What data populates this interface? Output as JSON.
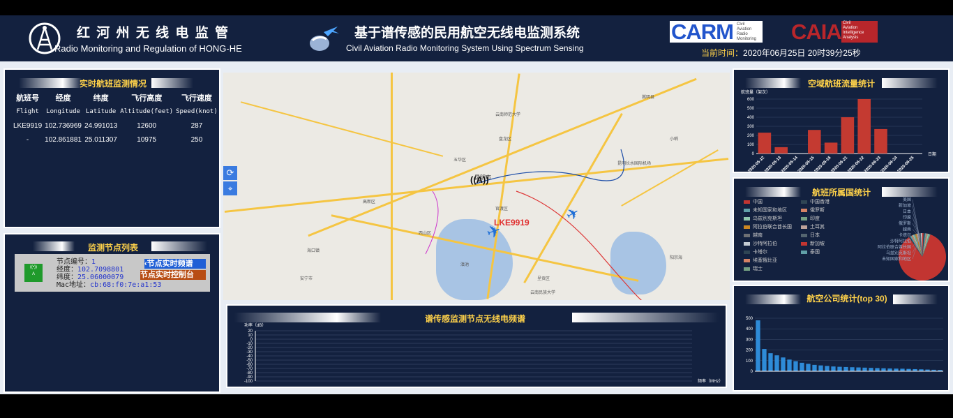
{
  "header": {
    "org_title": "红 河 州 无 线 电 监 管",
    "org_subtitle": "Radio Monitoring and Regulation of HONG-HE",
    "system_title": "基于谱传感的民用航空无线电监测系统",
    "system_subtitle": "Civil Aviation Radio Monitoring System Using Spectrum Sensing",
    "carm_logo": "CARM",
    "carm_tag": [
      "Civil",
      "Aviation",
      "Radio",
      "Monitoring"
    ],
    "caia_logo": "CAIA",
    "caia_tag": [
      "Civil",
      "Aviation",
      "Intelligence",
      "Analysis"
    ],
    "time_label": "当前时间：",
    "time_value": "2020年06月25日 20时39分25秒"
  },
  "flights_panel": {
    "title": "实时航班监测情况",
    "headers_cn": [
      "航班号",
      "经度",
      "纬度",
      "飞行高度",
      "飞行速度"
    ],
    "headers_en": [
      "Flight",
      "Longitude",
      "Latitude",
      "Altitude(feet)",
      "Speed(knot)"
    ],
    "rows": [
      [
        "LKE9919",
        "102.736969",
        "24.991013",
        "12600",
        "287"
      ],
      [
        "-",
        "102.861881",
        "25.011307",
        "10975",
        "250"
      ]
    ]
  },
  "nodes_panel": {
    "title": "监测节点列表",
    "node": {
      "id_label": "节点编号：",
      "id_value": "1",
      "lon_label": "经度：",
      "lon_value": "102.7098801",
      "lat_label": "纬度：",
      "lat_value": "25.06000079",
      "mac_label": "Mac地址：",
      "mac_value": "cb:68:f0:7e:a1:53"
    },
    "btn_spectrum": "节点实时频谱",
    "btn_control": "节点实时控制台"
  },
  "map": {
    "flight_label": "LKE9919",
    "refresh_icon": "refresh-icon",
    "locate_icon": "location-icon",
    "places": [
      "昆明市",
      "五华区",
      "盘龙区",
      "官渡区",
      "西山区",
      "呈贡区",
      "嵩明县",
      "云南师范大学",
      "云南民族大学",
      "昆明长水国际机场",
      "安宁市",
      "滇池",
      "高新区",
      "小哨",
      "海口镇",
      "阳宗海"
    ]
  },
  "spectrum_panel": {
    "title": "谱传感监测节点无线电频谱",
    "ylabel": "功率（dB）",
    "xlabel": "频率（MHz）"
  },
  "airspace_panel": {
    "title": "空域航班流量统计",
    "ylabel": "航班量（架次）",
    "xlabel": "日期"
  },
  "country_panel": {
    "title": "航班所属国统计",
    "legend_col1": [
      "中国",
      "未知国家和地区",
      "乌兹别克斯坦",
      "阿拉伯联合酋长国",
      "越南",
      "沙特阿拉伯",
      "卡塔尔",
      "埃塞俄比亚",
      "瑞士"
    ],
    "legend_col2": [
      "中国香港",
      "俄罗斯",
      "印度",
      "土耳其",
      "日本",
      "新加坡",
      "泰国"
    ],
    "pie_labels": [
      "美国",
      "新加坡",
      "日本",
      "印度",
      "俄罗斯",
      "越南",
      "卡塔尔",
      "沙特阿拉伯",
      "阿拉伯联合酋长国",
      "乌兹别克斯坦",
      "未知国家和地区"
    ]
  },
  "airline_panel": {
    "title": "航空公司统计(top 30)"
  },
  "chart_data": [
    {
      "type": "bar",
      "title": "空域航班流量统计",
      "ylabel": "航班量（架次）",
      "xlabel": "日期",
      "categories": [
        "2020-05-12",
        "2020-05-13",
        "2020-05-14",
        "2020-05-15",
        "2020-05-16",
        "2020-06-21",
        "2020-06-22",
        "2020-06-23",
        "2020-06-24",
        "2020-06-25"
      ],
      "values": [
        230,
        70,
        0,
        260,
        120,
        400,
        600,
        270,
        0,
        0
      ],
      "ylim": [
        0,
        600
      ],
      "yticks": [
        0,
        100,
        200,
        300,
        400,
        500,
        600
      ],
      "color": "#c43a31"
    },
    {
      "type": "pie",
      "title": "航班所属国统计",
      "categories": [
        "中国",
        "中国香港",
        "未知国家和地区",
        "俄罗斯",
        "乌兹别克斯坦",
        "印度",
        "阿拉伯联合酋长国",
        "土耳其",
        "越南",
        "日本",
        "沙特阿拉伯",
        "新加坡",
        "卡塔尔",
        "泰国",
        "埃塞俄比亚",
        "美国",
        "瑞士"
      ],
      "values": [
        90,
        1,
        1,
        1,
        1,
        1,
        1,
        1,
        1,
        1,
        1,
        1,
        1,
        1,
        1,
        1,
        1
      ],
      "colors": [
        "#c23531",
        "#2f4554",
        "#61a0a8",
        "#d48265",
        "#91c7ae",
        "#749f83",
        "#ca8622",
        "#bda29a",
        "#6e7074",
        "#546570",
        "#c4ccd3",
        "#c23531",
        "#2f4554",
        "#61a0a8",
        "#d48265",
        "#91c7ae",
        "#749f83"
      ]
    },
    {
      "type": "bar",
      "title": "航空公司统计(top 30)",
      "yticks": [
        0,
        100,
        200,
        300,
        400,
        500
      ],
      "ylim": [
        0,
        500
      ],
      "values": [
        480,
        210,
        170,
        150,
        130,
        110,
        95,
        80,
        70,
        60,
        55,
        50,
        45,
        42,
        40,
        38,
        36,
        34,
        32,
        30,
        28,
        26,
        25,
        24,
        22,
        20,
        18,
        16,
        14,
        12
      ],
      "color": "#2e8bd8"
    },
    {
      "type": "line",
      "title": "谱传感监测节点无线电频谱",
      "ylabel": "功率（dB）",
      "xlabel": "频率（MHz）",
      "yticks": [
        20,
        10,
        0,
        -10,
        -20,
        -30,
        -40,
        -50,
        -60,
        -70,
        -80,
        -90,
        -100
      ],
      "ylim": [
        -100,
        20
      ],
      "series": []
    }
  ]
}
